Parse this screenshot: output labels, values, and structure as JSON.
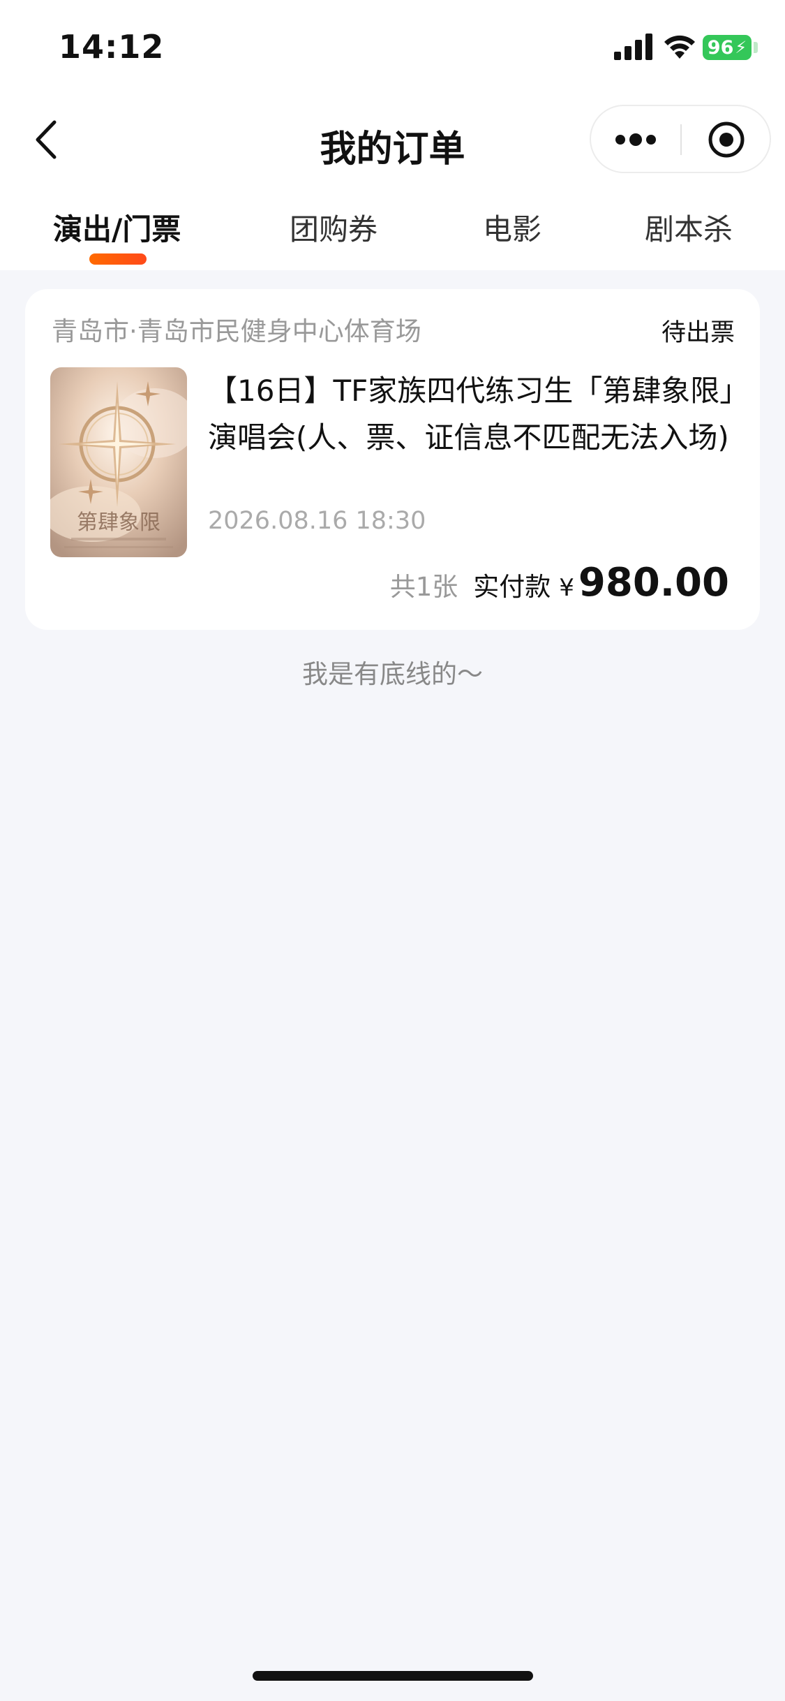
{
  "status_bar": {
    "time": "14:12",
    "battery": "96"
  },
  "header": {
    "title": "我的订单"
  },
  "tabs": [
    {
      "label": "演出/门票",
      "active": true
    },
    {
      "label": "团购券",
      "active": false
    },
    {
      "label": "电影",
      "active": false
    },
    {
      "label": "剧本杀",
      "active": false
    }
  ],
  "orders": [
    {
      "venue": "青岛市·青岛市民健身中心体育场",
      "status": "待出票",
      "title": "【16日】TF家族四代练习生「第肆象限」演唱会(人、票、证信息不匹配无法入场)",
      "datetime": "2026.08.16 18:30",
      "poster_text": "第肆象限",
      "ticket_count": "共1张",
      "paid_label": "实付款",
      "currency": "¥",
      "amount": "980.00"
    }
  ],
  "footer": {
    "end_text": "我是有底线的～"
  },
  "colors": {
    "accent": "#ff5a10",
    "battery": "#34c759",
    "background": "#f5f6fa"
  }
}
